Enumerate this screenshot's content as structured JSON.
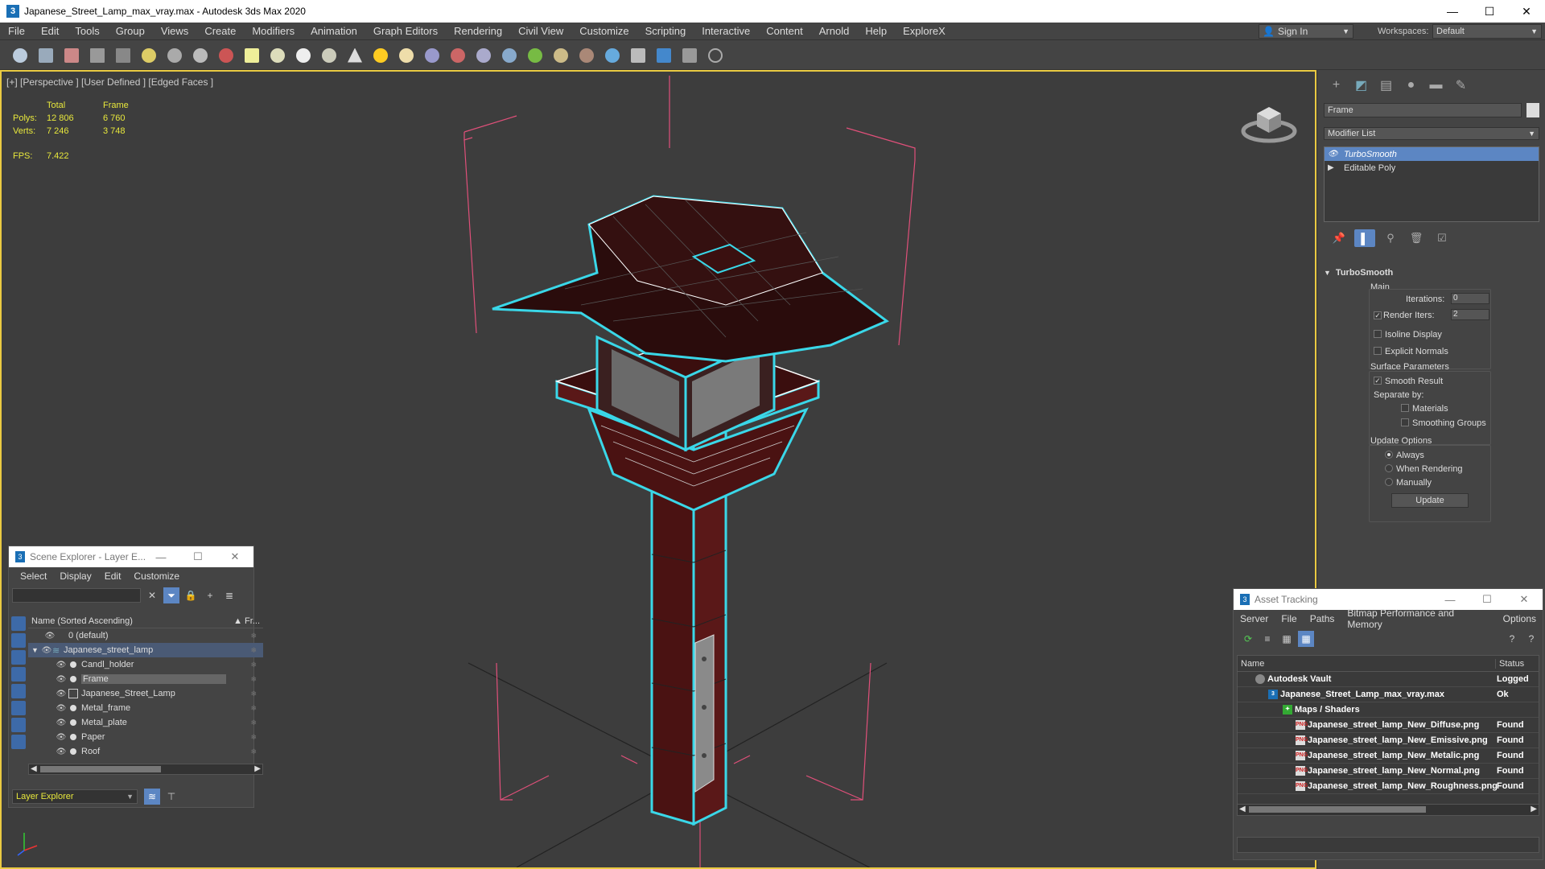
{
  "window": {
    "title": "Japanese_Street_Lamp_max_vray.max - Autodesk 3ds Max 2020",
    "icon_label": "3"
  },
  "menu": [
    "File",
    "Edit",
    "Tools",
    "Group",
    "Views",
    "Create",
    "Modifiers",
    "Animation",
    "Graph Editors",
    "Rendering",
    "Civil View",
    "Customize",
    "Scripting",
    "Interactive",
    "Content",
    "Arnold",
    "Help",
    "ExploreX"
  ],
  "signin": {
    "label": "Sign In"
  },
  "workspaces": {
    "label": "Workspaces:",
    "value": "Default"
  },
  "viewport": {
    "label": "[+] [Perspective ] [User Defined ] [Edged Faces ]",
    "stats": {
      "total_label": "Total",
      "frame_label": "Frame",
      "polys_label": "Polys:",
      "polys_total": "12 806",
      "polys_frame": "6 760",
      "verts_label": "Verts:",
      "verts_total": "7 246",
      "verts_frame": "3 748",
      "fps_label": "FPS:",
      "fps_value": "7.422"
    }
  },
  "command_panel": {
    "object_name": "Frame",
    "modifier_list": "Modifier List",
    "stack": [
      "TurboSmooth",
      "Editable Poly"
    ],
    "turbosmooth": {
      "title": "TurboSmooth",
      "main": "Main",
      "iterations_label": "Iterations:",
      "iterations": "0",
      "render_iters_label": "Render Iters:",
      "render_iters": "2",
      "isoline": "Isoline Display",
      "explicit_normals": "Explicit Normals",
      "surface_params": "Surface Parameters",
      "smooth_result": "Smooth Result",
      "separate_by": "Separate by:",
      "materials": "Materials",
      "smoothing_groups": "Smoothing Groups",
      "update_options": "Update Options",
      "always": "Always",
      "when_rendering": "When Rendering",
      "manually": "Manually",
      "update": "Update"
    }
  },
  "scene_explorer": {
    "title": "Scene Explorer - Layer E...",
    "menu": [
      "Select",
      "Display",
      "Edit",
      "Customize"
    ],
    "col_name": "Name (Sorted Ascending)",
    "col_fr": "▲ Fr...",
    "rows": [
      {
        "name": "0 (default)"
      },
      {
        "name": "Japanese_street_lamp"
      },
      {
        "name": "Candl_holder"
      },
      {
        "name": "Frame"
      },
      {
        "name": "Japanese_Street_Lamp"
      },
      {
        "name": "Metal_frame"
      },
      {
        "name": "Metal_plate"
      },
      {
        "name": "Paper"
      },
      {
        "name": "Roof"
      }
    ],
    "layer_explorer": "Layer Explorer"
  },
  "asset_tracking": {
    "title": "Asset Tracking",
    "menu": [
      "Server",
      "File",
      "Paths",
      "Bitmap Performance and Memory",
      "Options"
    ],
    "col_name": "Name",
    "col_status": "Status",
    "rows": [
      {
        "name": "Autodesk Vault",
        "status": "Logged"
      },
      {
        "name": "Japanese_Street_Lamp_max_vray.max",
        "status": "Ok"
      },
      {
        "name": "Maps / Shaders",
        "status": ""
      },
      {
        "name": "Japanese_street_lamp_New_Diffuse.png",
        "status": "Found"
      },
      {
        "name": "Japanese_street_lamp_New_Emissive.png",
        "status": "Found"
      },
      {
        "name": "Japanese_street_lamp_New_Metalic.png",
        "status": "Found"
      },
      {
        "name": "Japanese_street_lamp_New_Normal.png",
        "status": "Found"
      },
      {
        "name": "Japanese_street_lamp_New_Roughness.png",
        "status": "Found"
      }
    ]
  },
  "colors": {
    "accent": "#5c86c3",
    "viewport_border": "#eaca42",
    "stats_text": "#e8e83c",
    "selection_wire": "#3ad7e8",
    "gizmo": "#e0507a"
  }
}
